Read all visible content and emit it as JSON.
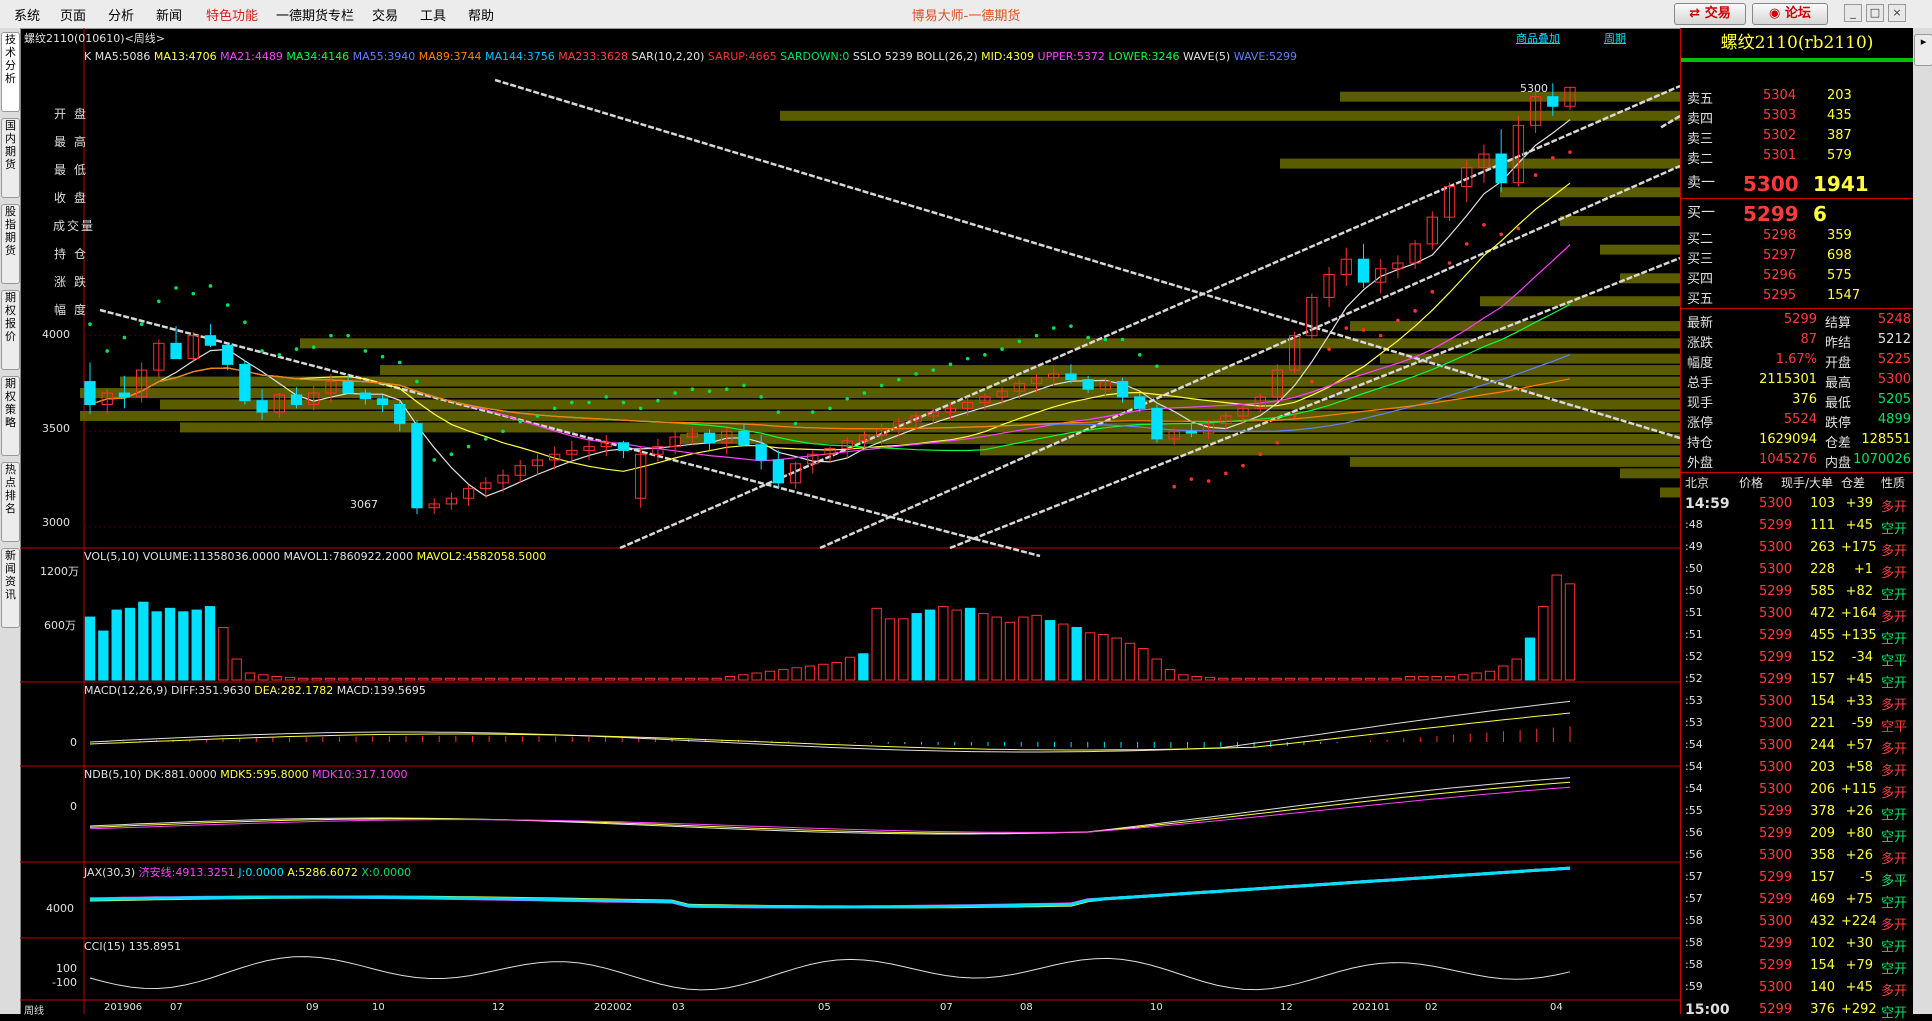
{
  "menu": [
    "系统",
    "页面",
    "分析",
    "新闻",
    "特色功能",
    "一德期货专栏",
    "交易",
    "工具",
    "帮助"
  ],
  "app_title": "博易大师-一德期货",
  "buttons": {
    "trade": "交易",
    "forum": "论坛"
  },
  "window_controls": [
    "_",
    "□",
    "×"
  ],
  "left_tabs": [
    "技术分析",
    "国内期货",
    "股指期货",
    "期权报价",
    "期权策略",
    "热点排名",
    "新闻资讯"
  ],
  "chart_header": {
    "symbol_label": "螺纹2110(010610)<周线>",
    "overlay_link": "商品叠加",
    "period_link": "周期"
  },
  "main_indicators": {
    "k": "K",
    "items": [
      {
        "text": "MA5:5086",
        "color": "#e0e0e0"
      },
      {
        "text": "MA13:4706",
        "color": "#ffff40"
      },
      {
        "text": "MA21:4489",
        "color": "#ff40ff"
      },
      {
        "text": "MA34:4146",
        "color": "#00ff40"
      },
      {
        "text": "MA55:3940",
        "color": "#6080ff"
      },
      {
        "text": "MA89:3744",
        "color": "#ff8000"
      },
      {
        "text": "MA144:3756",
        "color": "#00c0ff"
      },
      {
        "text": "MA233:3628",
        "color": "#ff4040"
      },
      {
        "text": "SAR(10,2,20)",
        "color": "#e0e0e0"
      },
      {
        "text": "SARUP:4665",
        "color": "#ff3030"
      },
      {
        "text": "SARDOWN:0",
        "color": "#00e060"
      },
      {
        "text": "SSLO 5239",
        "color": "#e0e0e0"
      },
      {
        "text": "BOLL(26,2)",
        "color": "#e0e0e0"
      },
      {
        "text": "MID:4309",
        "color": "#ffff40"
      },
      {
        "text": "UPPER:5372",
        "color": "#ff40ff"
      },
      {
        "text": "LOWER:3246",
        "color": "#00ff40"
      },
      {
        "text": "WAVE(5)",
        "color": "#e0e0e0"
      },
      {
        "text": "WAVE:5299",
        "color": "#6080ff"
      }
    ]
  },
  "ohlc_labels": [
    "开盘",
    "最高",
    "最低",
    "收盘",
    "成交量",
    "持仓",
    "涨跌",
    "幅度"
  ],
  "price_axis": [
    "4000",
    "3500",
    "3000"
  ],
  "price_annotations": {
    "high": "5300",
    "low": "3067"
  },
  "vol_header": {
    "name": "VOL(5,10)",
    "volume": "VOLUME:11358036.0000",
    "mavol1": "MAVOL1:7860922.2000",
    "mavol2": "MAVOL2:4582058.5000"
  },
  "vol_axis": [
    "1200万",
    "600万"
  ],
  "macd_header": {
    "name": "MACD(12,26,9)",
    "diff": "DIFF:351.9630",
    "dea": "DEA:282.1782",
    "macd": "MACD:139.5695"
  },
  "macd_axis": "0",
  "ndb_header": {
    "name": "NDB(5,10)",
    "dk": "DK:881.0000",
    "mdk5": "MDK5:595.8000",
    "mdk10": "MDK10:317.1000"
  },
  "ndb_axis": "0",
  "jax_header": {
    "name": "JAX(30,3)",
    "jisha": "济安线:4913.3251",
    "j": "J:0.0000",
    "a": "A:5286.6072",
    "x": "X:0.0000"
  },
  "jax_axis": "4000",
  "cci_header": {
    "name": "CCI(15)",
    "value": "135.8951"
  },
  "cci_axis": [
    "100",
    "-100"
  ],
  "time_axis": [
    "周线",
    "201906",
    "07",
    "09",
    "10",
    "12",
    "202002",
    "03",
    "05",
    "07",
    "08",
    "10",
    "12",
    "202101",
    "02",
    "04"
  ],
  "quote": {
    "title": "螺纹2110(rb2110)",
    "asks": [
      {
        "label": "卖五",
        "price": "5304",
        "vol": "203"
      },
      {
        "label": "卖四",
        "price": "5303",
        "vol": "435"
      },
      {
        "label": "卖三",
        "price": "5302",
        "vol": "387"
      },
      {
        "label": "卖二",
        "price": "5301",
        "vol": "579"
      },
      {
        "label": "卖一",
        "price": "5300",
        "vol": "1941"
      }
    ],
    "bids": [
      {
        "label": "买一",
        "price": "5299",
        "vol": "6"
      },
      {
        "label": "买二",
        "price": "5298",
        "vol": "359"
      },
      {
        "label": "买三",
        "price": "5297",
        "vol": "698"
      },
      {
        "label": "买四",
        "price": "5296",
        "vol": "575"
      },
      {
        "label": "买五",
        "price": "5295",
        "vol": "1547"
      }
    ],
    "stats": [
      {
        "l1": "最新",
        "v1": "5299",
        "c1": "red",
        "l2": "结算",
        "v2": "5248",
        "c2": "red"
      },
      {
        "l1": "涨跌",
        "v1": "87",
        "c1": "red",
        "l2": "昨结",
        "v2": "5212",
        "c2": "white"
      },
      {
        "l1": "幅度",
        "v1": "1.67%",
        "c1": "red",
        "l2": "开盘",
        "v2": "5225",
        "c2": "red"
      },
      {
        "l1": "总手",
        "v1": "2115301",
        "c1": "yellow",
        "l2": "最高",
        "v2": "5300",
        "c2": "red"
      },
      {
        "l1": "现手",
        "v1": "376",
        "c1": "yellow",
        "l2": "最低",
        "v2": "5205",
        "c2": "green"
      },
      {
        "l1": "涨停",
        "v1": "5524",
        "c1": "red",
        "l2": "跌停",
        "v2": "4899",
        "c2": "green"
      },
      {
        "l1": "持仓",
        "v1": "1629094",
        "c1": "yellow",
        "l2": "仓差",
        "v2": "128551",
        "c2": "yellow"
      },
      {
        "l1": "外盘",
        "v1": "1045276",
        "c1": "red",
        "l2": "内盘",
        "v2": "1070026",
        "c2": "green"
      }
    ],
    "tick_header": [
      "北京",
      "价格",
      "现手/大单",
      "仓差",
      "性质"
    ],
    "ticks": [
      {
        "t": "14:59",
        "p": "5300",
        "v": "103",
        "d": "+39",
        "n": "多开",
        "nc": "red"
      },
      {
        "t": ":48",
        "p": "5299",
        "v": "111",
        "d": "+45",
        "n": "空开",
        "nc": "green"
      },
      {
        "t": ":49",
        "p": "5300",
        "v": "263",
        "d": "+175",
        "n": "多开",
        "nc": "red"
      },
      {
        "t": ":50",
        "p": "5300",
        "v": "228",
        "d": "+1",
        "n": "多开",
        "nc": "red"
      },
      {
        "t": ":50",
        "p": "5299",
        "v": "585",
        "d": "+82",
        "n": "空开",
        "nc": "green"
      },
      {
        "t": ":51",
        "p": "5300",
        "v": "472",
        "d": "+164",
        "n": "多开",
        "nc": "red"
      },
      {
        "t": ":51",
        "p": "5299",
        "v": "455",
        "d": "+135",
        "n": "空开",
        "nc": "green"
      },
      {
        "t": ":52",
        "p": "5299",
        "v": "152",
        "d": "-34",
        "n": "空平",
        "nc": "green"
      },
      {
        "t": ":52",
        "p": "5299",
        "v": "157",
        "d": "+45",
        "n": "空开",
        "nc": "green"
      },
      {
        "t": ":53",
        "p": "5300",
        "v": "154",
        "d": "+33",
        "n": "多开",
        "nc": "red"
      },
      {
        "t": ":53",
        "p": "5300",
        "v": "221",
        "d": "-59",
        "n": "空平",
        "nc": "red"
      },
      {
        "t": ":54",
        "p": "5300",
        "v": "244",
        "d": "+57",
        "n": "多开",
        "nc": "red"
      },
      {
        "t": ":54",
        "p": "5300",
        "v": "203",
        "d": "+58",
        "n": "多开",
        "nc": "red"
      },
      {
        "t": ":54",
        "p": "5300",
        "v": "206",
        "d": "+115",
        "n": "多开",
        "nc": "red"
      },
      {
        "t": ":55",
        "p": "5299",
        "v": "378",
        "d": "+26",
        "n": "空开",
        "nc": "green"
      },
      {
        "t": ":56",
        "p": "5299",
        "v": "209",
        "d": "+80",
        "n": "空开",
        "nc": "green"
      },
      {
        "t": ":56",
        "p": "5300",
        "v": "358",
        "d": "+26",
        "n": "多开",
        "nc": "red"
      },
      {
        "t": ":57",
        "p": "5299",
        "v": "157",
        "d": "-5",
        "n": "多平",
        "nc": "green"
      },
      {
        "t": ":57",
        "p": "5299",
        "v": "469",
        "d": "+75",
        "n": "空开",
        "nc": "green"
      },
      {
        "t": ":58",
        "p": "5300",
        "v": "432",
        "d": "+224",
        "n": "多开",
        "nc": "red"
      },
      {
        "t": ":58",
        "p": "5299",
        "v": "102",
        "d": "+30",
        "n": "空开",
        "nc": "green"
      },
      {
        "t": ":58",
        "p": "5299",
        "v": "154",
        "d": "+79",
        "n": "空开",
        "nc": "green"
      },
      {
        "t": ":59",
        "p": "5300",
        "v": "140",
        "d": "+45",
        "n": "多开",
        "nc": "red"
      },
      {
        "t": "15:00",
        "p": "5299",
        "v": "376",
        "d": "+292",
        "n": "空开",
        "nc": "green"
      }
    ]
  },
  "chart_data": {
    "type": "candlestick",
    "period": "周线",
    "price_range": [
      2900,
      5400
    ],
    "candles": [
      [
        3760,
        3860,
        3590,
        3640
      ],
      [
        3640,
        3720,
        3590,
        3700
      ],
      [
        3700,
        3790,
        3620,
        3680
      ],
      [
        3680,
        3860,
        3650,
        3820
      ],
      [
        3820,
        3980,
        3780,
        3960
      ],
      [
        3960,
        4050,
        3900,
        3880
      ],
      [
        3880,
        4020,
        3860,
        4000
      ],
      [
        4000,
        4060,
        3940,
        3950
      ],
      [
        3950,
        3960,
        3820,
        3850
      ],
      [
        3850,
        3870,
        3640,
        3660
      ],
      [
        3660,
        3720,
        3560,
        3600
      ],
      [
        3600,
        3700,
        3570,
        3690
      ],
      [
        3690,
        3730,
        3620,
        3640
      ],
      [
        3640,
        3740,
        3610,
        3700
      ],
      [
        3700,
        3800,
        3650,
        3760
      ],
      [
        3760,
        3800,
        3700,
        3700
      ],
      [
        3700,
        3720,
        3640,
        3670
      ],
      [
        3670,
        3690,
        3600,
        3640
      ],
      [
        3640,
        3660,
        3500,
        3540
      ],
      [
        3540,
        3560,
        3067,
        3100
      ],
      [
        3100,
        3150,
        3067,
        3120
      ],
      [
        3120,
        3180,
        3090,
        3150
      ],
      [
        3150,
        3220,
        3110,
        3200
      ],
      [
        3200,
        3260,
        3150,
        3230
      ],
      [
        3230,
        3300,
        3180,
        3270
      ],
      [
        3270,
        3350,
        3230,
        3320
      ],
      [
        3320,
        3380,
        3270,
        3350
      ],
      [
        3350,
        3420,
        3300,
        3380
      ],
      [
        3380,
        3450,
        3340,
        3400
      ],
      [
        3400,
        3450,
        3350,
        3420
      ],
      [
        3420,
        3480,
        3370,
        3440
      ],
      [
        3440,
        3450,
        3360,
        3400
      ],
      [
        3150,
        3420,
        3100,
        3380
      ],
      [
        3380,
        3460,
        3340,
        3420
      ],
      [
        3420,
        3500,
        3380,
        3470
      ],
      [
        3470,
        3520,
        3430,
        3490
      ],
      [
        3490,
        3510,
        3400,
        3440
      ],
      [
        3440,
        3520,
        3380,
        3500
      ],
      [
        3500,
        3540,
        3420,
        3430
      ],
      [
        3430,
        3480,
        3300,
        3350
      ],
      [
        3350,
        3400,
        3200,
        3230
      ],
      [
        3230,
        3340,
        3200,
        3330
      ],
      [
        3330,
        3400,
        3280,
        3380
      ],
      [
        3380,
        3420,
        3340,
        3410
      ],
      [
        3410,
        3470,
        3360,
        3450
      ],
      [
        3450,
        3500,
        3410,
        3480
      ],
      [
        3480,
        3540,
        3430,
        3510
      ],
      [
        3510,
        3570,
        3470,
        3550
      ],
      [
        3550,
        3600,
        3510,
        3580
      ],
      [
        3580,
        3620,
        3540,
        3600
      ],
      [
        3600,
        3650,
        3560,
        3620
      ],
      [
        3620,
        3680,
        3580,
        3650
      ],
      [
        3650,
        3700,
        3610,
        3680
      ],
      [
        3680,
        3730,
        3640,
        3710
      ],
      [
        3710,
        3770,
        3670,
        3750
      ],
      [
        3750,
        3800,
        3700,
        3780
      ],
      [
        3780,
        3840,
        3740,
        3800
      ],
      [
        3800,
        3850,
        3750,
        3770
      ],
      [
        3770,
        3790,
        3700,
        3720
      ],
      [
        3720,
        3780,
        3680,
        3760
      ],
      [
        3760,
        3780,
        3650,
        3680
      ],
      [
        3680,
        3700,
        3600,
        3620
      ],
      [
        3620,
        3640,
        3440,
        3460
      ],
      [
        3460,
        3520,
        3430,
        3500
      ],
      [
        3500,
        3540,
        3470,
        3490
      ],
      [
        3490,
        3560,
        3460,
        3540
      ],
      [
        3540,
        3600,
        3500,
        3580
      ],
      [
        3580,
        3640,
        3540,
        3620
      ],
      [
        3620,
        3700,
        3600,
        3680
      ],
      [
        3680,
        3850,
        3660,
        3820
      ],
      [
        3820,
        4020,
        3800,
        4000
      ],
      [
        4000,
        4220,
        3980,
        4200
      ],
      [
        4200,
        4360,
        4150,
        4320
      ],
      [
        4320,
        4460,
        4260,
        4400
      ],
      [
        4400,
        4480,
        4250,
        4280
      ],
      [
        4280,
        4400,
        4220,
        4350
      ],
      [
        4350,
        4420,
        4300,
        4380
      ],
      [
        4380,
        4500,
        4350,
        4480
      ],
      [
        4480,
        4650,
        4450,
        4620
      ],
      [
        4620,
        4800,
        4600,
        4780
      ],
      [
        4780,
        4920,
        4700,
        4880
      ],
      [
        4880,
        5000,
        4800,
        4950
      ],
      [
        4950,
        5080,
        4750,
        4800
      ],
      [
        4800,
        5150,
        4780,
        5100
      ],
      [
        5100,
        5300,
        5060,
        5250
      ],
      [
        5250,
        5320,
        5150,
        5200
      ],
      [
        5200,
        5300,
        5180,
        5299
      ]
    ],
    "volume_unit": "万",
    "volume_range": [
      0,
      1350
    ],
    "volumes": [
      720,
      560,
      800,
      820,
      890,
      780,
      820,
      780,
      800,
      840,
      600,
      240,
      80,
      60,
      40,
      30,
      20,
      20,
      20,
      20,
      20,
      20,
      20,
      20,
      20,
      20,
      20,
      20,
      20,
      20,
      20,
      20,
      20,
      20,
      20,
      20,
      20,
      20,
      20,
      20,
      20,
      20,
      20,
      20,
      20,
      20,
      20,
      20,
      40,
      60,
      80,
      100,
      120,
      140,
      160,
      180,
      200,
      260,
      300,
      820,
      700,
      700,
      760,
      800,
      840,
      800,
      820,
      760,
      720,
      660,
      720,
      740,
      680,
      640,
      600,
      540,
      520,
      480,
      420,
      360,
      240,
      120,
      60,
      40,
      30,
      20,
      20,
      20,
      20,
      20,
      20,
      20,
      20,
      20,
      20,
      20,
      20,
      20,
      20,
      40,
      40,
      40,
      40,
      60,
      80,
      100,
      160,
      240,
      480,
      840,
      1200,
      1100
    ]
  }
}
